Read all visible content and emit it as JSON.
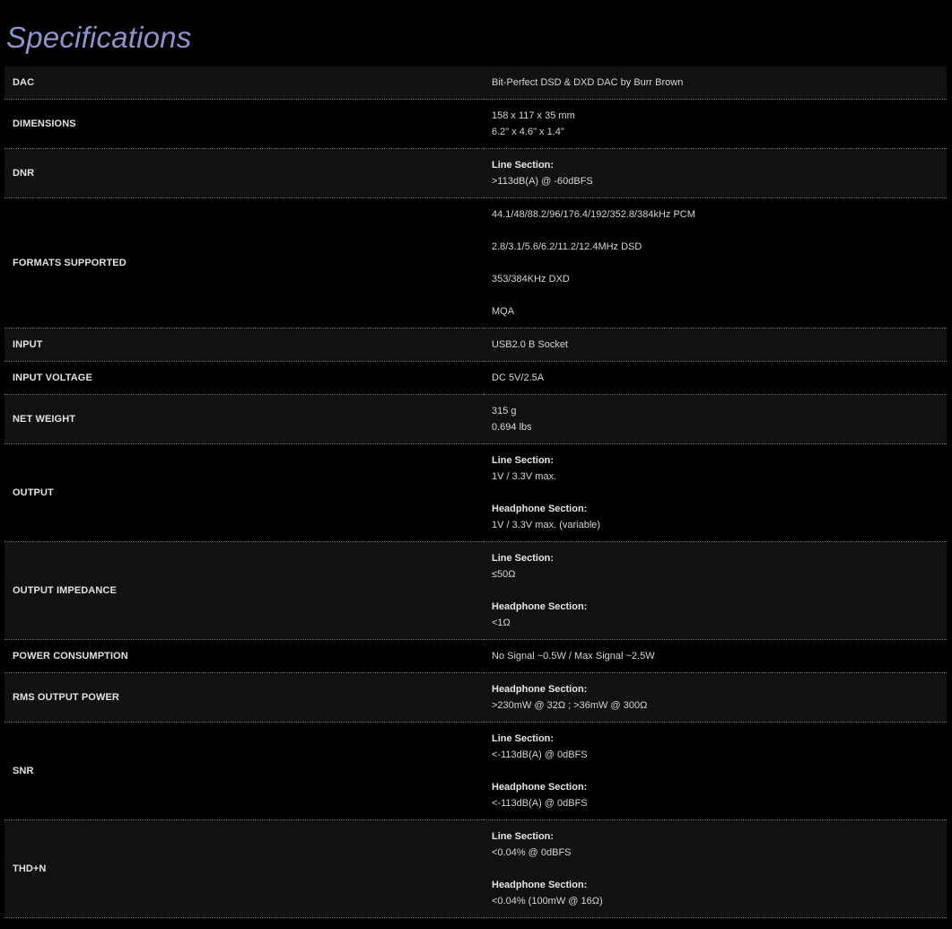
{
  "title": "Specifications",
  "rows": [
    {
      "label": "DAC",
      "lines": [
        {
          "text": "Bit-Perfect DSD & DXD DAC by Burr Brown"
        }
      ]
    },
    {
      "label": "DIMENSIONS",
      "lines": [
        {
          "text": "158 x 117 x 35 mm"
        },
        {
          "text": "6.2\" x 4.6\" x 1.4\""
        }
      ]
    },
    {
      "label": "DNR",
      "lines": [
        {
          "text": "Line Section:",
          "bold": true
        },
        {
          "text": ">113dB(A) @ -60dBFS"
        }
      ]
    },
    {
      "label": "FORMATS SUPPORTED",
      "lines": [
        {
          "text": "44.1/48/88.2/96/176.4/192/352.8/384kHz PCM"
        },
        {
          "text": ""
        },
        {
          "text": "2.8/3.1/5.6/6.2/11.2/12.4MHz DSD"
        },
        {
          "text": ""
        },
        {
          "text": "353/384KHz DXD"
        },
        {
          "text": ""
        },
        {
          "text": "MQA"
        }
      ]
    },
    {
      "label": "INPUT",
      "lines": [
        {
          "text": "USB2.0 B Socket"
        }
      ]
    },
    {
      "label": "INPUT VOLTAGE",
      "lines": [
        {
          "text": "DC 5V/2.5A"
        }
      ]
    },
    {
      "label": "NET WEIGHT",
      "lines": [
        {
          "text": "315 g"
        },
        {
          "text": "0.694 lbs"
        }
      ]
    },
    {
      "label": "OUTPUT",
      "lines": [
        {
          "text": "Line Section:",
          "bold": true
        },
        {
          "text": "1V / 3.3V max."
        },
        {
          "text": ""
        },
        {
          "text": "Headphone Section:",
          "bold": true
        },
        {
          "text": "1V / 3.3V max. (variable)"
        }
      ]
    },
    {
      "label": "OUTPUT IMPEDANCE",
      "lines": [
        {
          "text": "Line Section:",
          "bold": true
        },
        {
          "text": "≤50Ω"
        },
        {
          "text": ""
        },
        {
          "text": "Headphone Section:",
          "bold": true
        },
        {
          "text": "<1Ω"
        }
      ]
    },
    {
      "label": "POWER CONSUMPTION",
      "lines": [
        {
          "text": "No Signal ~0.5W / Max Signal ~2.5W"
        }
      ]
    },
    {
      "label": "RMS OUTPUT POWER",
      "lines": [
        {
          "text": "Headphone Section:",
          "bold": true
        },
        {
          "text": ">230mW @ 32Ω ; >36mW @ 300Ω"
        }
      ]
    },
    {
      "label": "SNR",
      "lines": [
        {
          "text": "Line Section:",
          "bold": true
        },
        {
          "text": "<-113dB(A) @ 0dBFS"
        },
        {
          "text": ""
        },
        {
          "text": "Headphone Section:",
          "bold": true
        },
        {
          "text": "<-113dB(A) @ 0dBFS"
        }
      ]
    },
    {
      "label": "THD+N",
      "lines": [
        {
          "text": "Line Section:",
          "bold": true
        },
        {
          "text": "<0.04% @ 0dBFS"
        },
        {
          "text": ""
        },
        {
          "text": "Headphone Section:",
          "bold": true
        },
        {
          "text": "<0.04% (100mW @ 16Ω)"
        }
      ]
    }
  ]
}
